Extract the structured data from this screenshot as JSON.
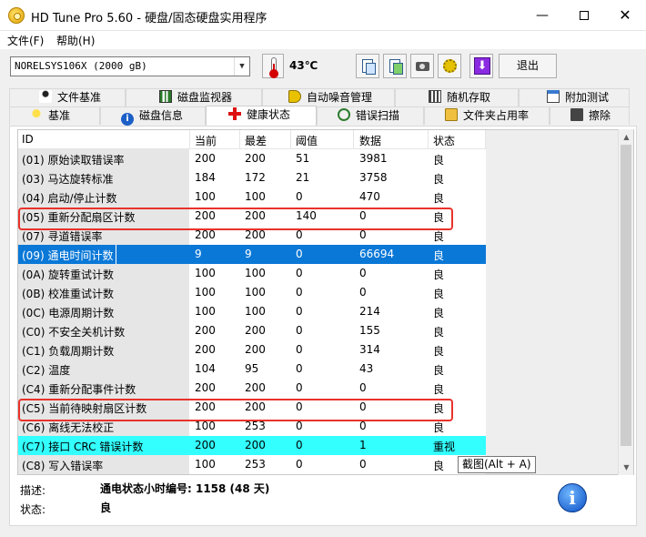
{
  "window": {
    "title": "HD Tune Pro 5.60 - 硬盘/固态硬盘实用程序",
    "min": "—",
    "close": "✕"
  },
  "menu": {
    "file": "文件(F)",
    "help": "帮助(H)"
  },
  "toolbar": {
    "drive": "NORELSYS106X (2000 gB)",
    "temperature": "43℃",
    "exit": "退出"
  },
  "tabs_top": [
    "文件基准",
    "磁盘监视器",
    "自动噪音管理",
    "随机存取",
    "附加测试"
  ],
  "tabs_bottom": [
    "基准",
    "磁盘信息",
    "健康状态",
    "错误扫描",
    "文件夹占用率",
    "擦除"
  ],
  "active_tab": "健康状态",
  "table": {
    "headers": {
      "id": "ID",
      "current": "当前",
      "worst": "最差",
      "threshold": "阈值",
      "data": "数据",
      "status": "状态"
    },
    "rows": [
      {
        "id": "(01) 原始读取错误率",
        "current": "200",
        "worst": "200",
        "threshold": "51",
        "data": "3981",
        "status": "良"
      },
      {
        "id": "(03) 马达旋转标准",
        "current": "184",
        "worst": "172",
        "threshold": "21",
        "data": "3758",
        "status": "良"
      },
      {
        "id": "(04) 启动/停止计数",
        "current": "100",
        "worst": "100",
        "threshold": "0",
        "data": "470",
        "status": "良"
      },
      {
        "id": "(05) 重新分配扇区计数",
        "current": "200",
        "worst": "200",
        "threshold": "140",
        "data": "0",
        "status": "良"
      },
      {
        "id": "(07) 寻道错误率",
        "current": "200",
        "worst": "200",
        "threshold": "0",
        "data": "0",
        "status": "良"
      },
      {
        "id": "(09) 通电时间计数",
        "current": "9",
        "worst": "9",
        "threshold": "0",
        "data": "66694",
        "status": "良"
      },
      {
        "id": "(0A) 旋转重试计数",
        "current": "100",
        "worst": "100",
        "threshold": "0",
        "data": "0",
        "status": "良"
      },
      {
        "id": "(0B) 校准重试计数",
        "current": "100",
        "worst": "100",
        "threshold": "0",
        "data": "0",
        "status": "良"
      },
      {
        "id": "(0C) 电源周期计数",
        "current": "100",
        "worst": "100",
        "threshold": "0",
        "data": "214",
        "status": "良"
      },
      {
        "id": "(C0) 不安全关机计数",
        "current": "200",
        "worst": "200",
        "threshold": "0",
        "data": "155",
        "status": "良"
      },
      {
        "id": "(C1) 负载周期计数",
        "current": "200",
        "worst": "200",
        "threshold": "0",
        "data": "314",
        "status": "良"
      },
      {
        "id": "(C2) 温度",
        "current": "104",
        "worst": "95",
        "threshold": "0",
        "data": "43",
        "status": "良"
      },
      {
        "id": "(C4) 重新分配事件计数",
        "current": "200",
        "worst": "200",
        "threshold": "0",
        "data": "0",
        "status": "良"
      },
      {
        "id": "(C5) 当前待映射扇区计数",
        "current": "200",
        "worst": "200",
        "threshold": "0",
        "data": "0",
        "status": "良"
      },
      {
        "id": "(C6) 离线无法校正",
        "current": "100",
        "worst": "253",
        "threshold": "0",
        "data": "0",
        "status": "良"
      },
      {
        "id": "(C7) 接口 CRC 错误计数",
        "current": "200",
        "worst": "200",
        "threshold": "0",
        "data": "1",
        "status": "重视"
      },
      {
        "id": "(C8) 写入错误率",
        "current": "100",
        "worst": "253",
        "threshold": "0",
        "data": "0",
        "status": "良"
      }
    ]
  },
  "tooltip": "截图(Alt + A)",
  "description": {
    "label": "描述:",
    "text": "通电状态小时编号: 1158 (48 天)"
  },
  "status": {
    "label": "状态:",
    "text": "良"
  },
  "colors": {
    "selection": "#0a78d7",
    "warning_row": "#33ffff",
    "highlight_box": "#e8322b"
  }
}
